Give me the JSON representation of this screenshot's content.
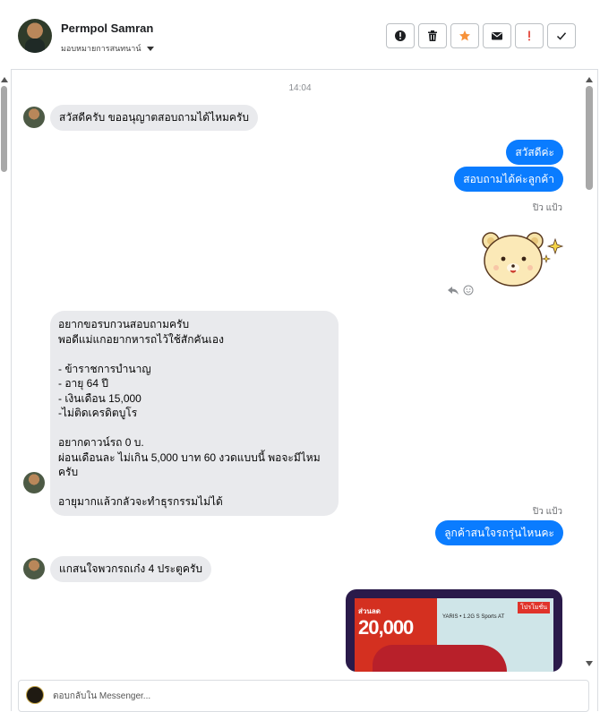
{
  "contact": {
    "name": "Permpol Samran",
    "subtitle": "มอบหมายการสนทนาน์"
  },
  "header_actions": [
    {
      "icon": "alert-circle-icon",
      "label": "Report"
    },
    {
      "icon": "trash-icon",
      "label": "Delete"
    },
    {
      "icon": "star-icon",
      "label": "Star",
      "color": "#f7923a"
    },
    {
      "icon": "envelope-icon",
      "label": "Mark unread"
    },
    {
      "icon": "exclamation-icon",
      "label": "Spam",
      "color": "#e4463b"
    },
    {
      "icon": "check-icon",
      "label": "Done"
    }
  ],
  "conversation": {
    "timestamp": "14:04",
    "messages": [
      {
        "from": "customer",
        "text": "สวัสดีครับ ขออนุญาตสอบถามได้ไหมครับ"
      },
      {
        "from": "page",
        "text": "สวัสดีค่ะ"
      },
      {
        "from": "page",
        "text": "สอบถามได้ค่ะลูกค้า"
      },
      {
        "from": "page",
        "sender": "ปิว แป้ว",
        "sticker": "bear-sticker"
      },
      {
        "from": "customer",
        "lines": [
          "อยากขอรบกวนสอบถามครับ",
          "พอดีแม่แกอยากหารถไว้ใช้สักคันเอง",
          "",
          "- ข้าราชการบำนาญ",
          "- อายุ 64 ปี",
          "- เงินเดือน 15,000",
          "-ไม่ติดเครดิตบูโร",
          "",
          "อยากดาวน์รถ 0 บ.",
          "ผ่อนเดือนละ ไม่เกิน 5,000 บาท 60 งวดแบบนี้ พอจะมีไหมครับ",
          "",
          "อายุมากแล้วกลัวจะทำธุรกรรมไม่ได้"
        ]
      },
      {
        "from": "page",
        "sender": "ปิว แป้ว",
        "text": "ลูกค้าสนใจรถรุ่นไหนคะ"
      },
      {
        "from": "customer",
        "text": "แกสนใจพวกรถเก๋ง 4 ประตูครับ"
      },
      {
        "from": "page",
        "image": {
          "badge": "ส่วนลด",
          "price": "20,000",
          "model": "YARIS • 1.2G S Sports AT",
          "tag": "โปรโมชั่น"
        }
      }
    ]
  },
  "composer": {
    "placeholder": "ตอบกลับใน Messenger..."
  },
  "colors": {
    "outgoing_bubble": "#0a7cff",
    "incoming_bubble": "#e9eaed"
  }
}
